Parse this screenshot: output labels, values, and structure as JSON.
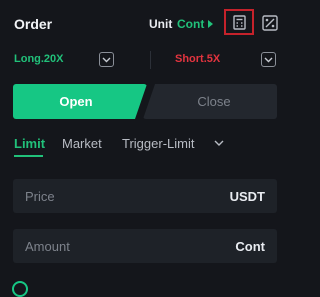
{
  "header": {
    "title": "Order",
    "unit_label": "Unit",
    "unit_value": "Cont",
    "icons": {
      "calculator": "calculator-icon",
      "pnl": "pnl-percent-icon",
      "unit_caret": "caret-right-icon"
    }
  },
  "leverage": {
    "long_label": "Long.20X",
    "short_label": "Short.5X"
  },
  "actions": {
    "open_label": "Open",
    "close_label": "Close"
  },
  "tabs": [
    {
      "label": "Limit",
      "active": true
    },
    {
      "label": "Market",
      "active": false
    },
    {
      "label": "Trigger-Limit",
      "active": false
    }
  ],
  "price_field": {
    "placeholder": "Price",
    "unit": "USDT"
  },
  "amount_field": {
    "placeholder": "Amount",
    "unit": "Cont"
  },
  "colors": {
    "accent_green": "#16c784",
    "accent_red": "#e3343f",
    "highlight_border": "#c5222b",
    "background": "#14161b"
  }
}
